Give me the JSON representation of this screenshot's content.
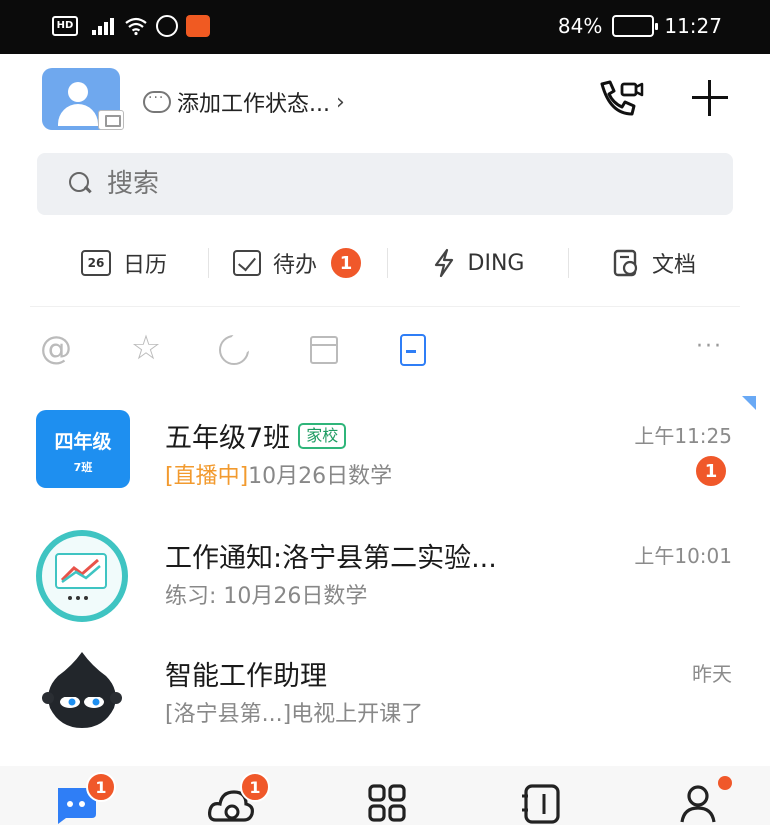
{
  "status_bar": {
    "hd_label": "HD",
    "battery_text": "84%",
    "time": "11:27"
  },
  "header": {
    "work_status_link": "添加工作状态...",
    "chevron": "›"
  },
  "search": {
    "placeholder": "搜索"
  },
  "tools": [
    {
      "label": "日历",
      "icon": "calendar-icon",
      "icon_text": "26"
    },
    {
      "label": "待办",
      "icon": "todo-check-icon",
      "badge": "1"
    },
    {
      "label": "DING",
      "icon": "ding-bolt-icon"
    },
    {
      "label": "文档",
      "icon": "document-icon"
    }
  ],
  "filters": {
    "mention_symbol": "@",
    "star_symbol": "☆",
    "more_symbol": "···"
  },
  "chats": [
    {
      "avatar_line1": "四年级",
      "avatar_line2": "7班",
      "title": "五年级7班",
      "tag": "家校",
      "subtitle_live": "[直播中]",
      "subtitle": "10月26日数学",
      "time": "上午11:25",
      "badge": "1"
    },
    {
      "title": "工作通知:洛宁县第二实验...",
      "subtitle": "练习: 10月26日数学",
      "time": "上午10:01"
    },
    {
      "title": "智能工作助理",
      "subtitle": "[洛宁县第...]电视上开课了",
      "time": "昨天"
    }
  ],
  "tabbar": {
    "messages_badge": "1",
    "docs_badge": "1"
  },
  "colors": {
    "accent_blue": "#2f7ef6",
    "badge_red": "#f0582a",
    "live_orange": "#f29a2e",
    "tag_green": "#2fb57a"
  }
}
